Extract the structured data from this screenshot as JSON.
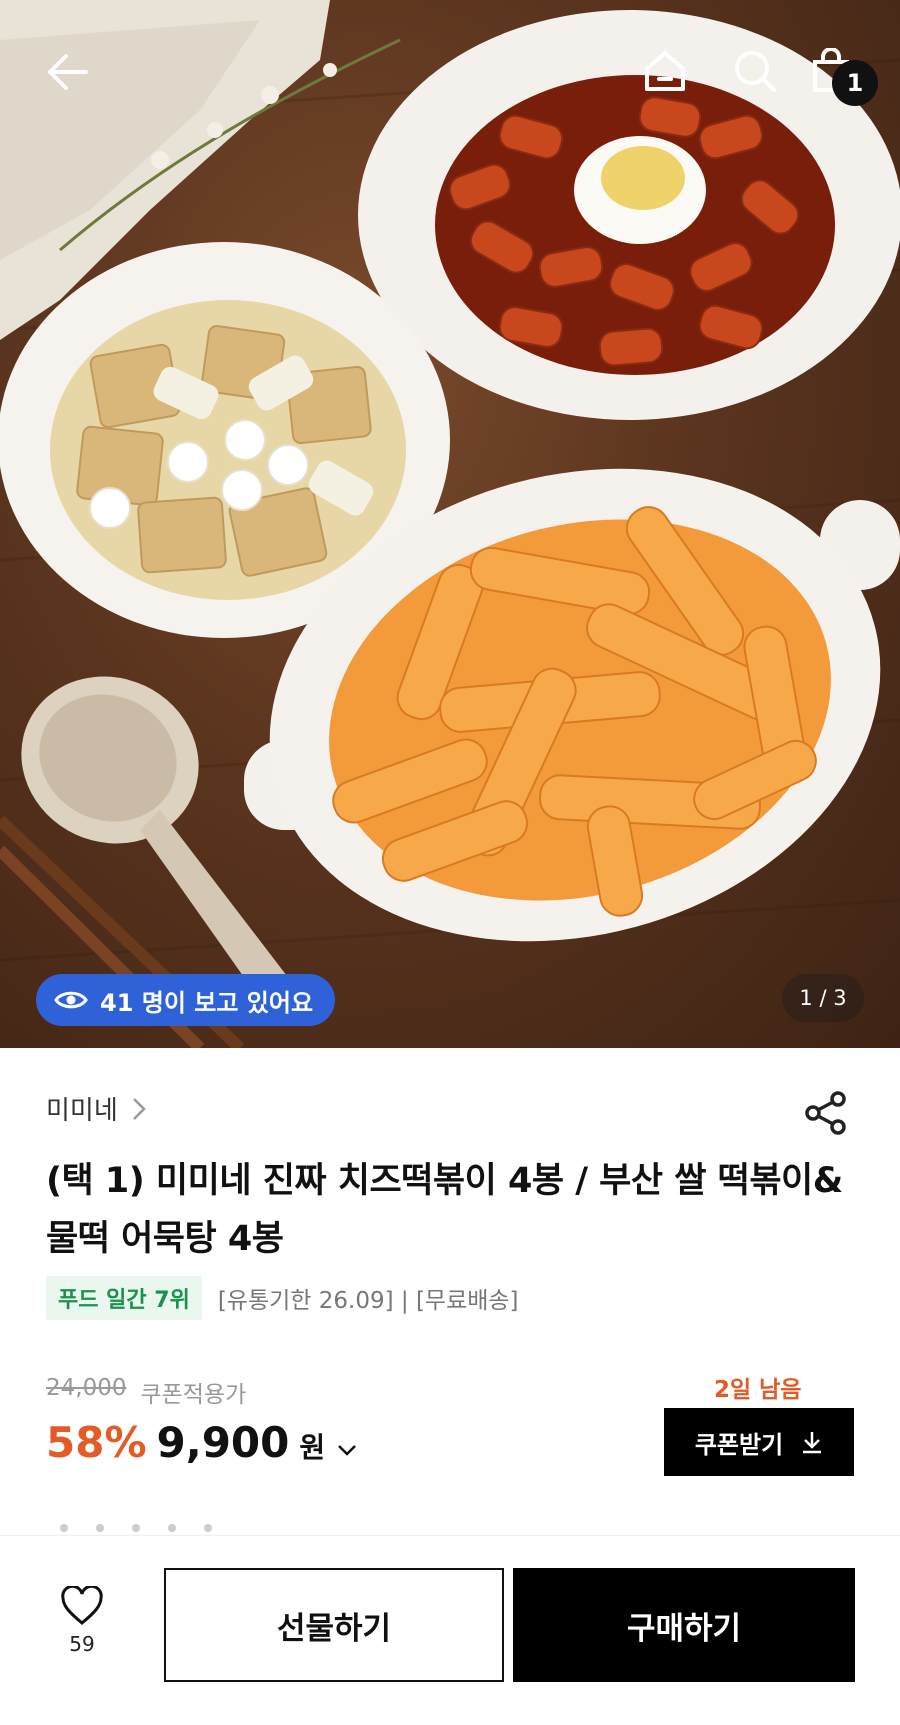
{
  "hero": {
    "viewers_text": "41 명이 보고 있어요",
    "pager": "1 / 3",
    "cart_count": "1"
  },
  "product": {
    "brand": "미미네",
    "title": "(택 1) 미미네 진짜 치즈떡볶이 4봉 / 부산 쌀 떡볶이&물떡 어묵탕 4봉",
    "rank_badge": "푸드 일간 7위",
    "tags": "[유통기한 26.09] | [무료배송]",
    "original_price": "24,000",
    "coupon_label": "쿠폰적용가",
    "discount": "58%",
    "final_price": "9,900",
    "currency": "원",
    "days_left": "2일 남음",
    "coupon_button": "쿠폰받기"
  },
  "bottom": {
    "like_count": "59",
    "gift_button": "선물하기",
    "buy_button": "구매하기"
  },
  "colors": {
    "accent": "#e35b26",
    "badge_blue": "#2f62d8",
    "rank_green": "#17934c"
  }
}
